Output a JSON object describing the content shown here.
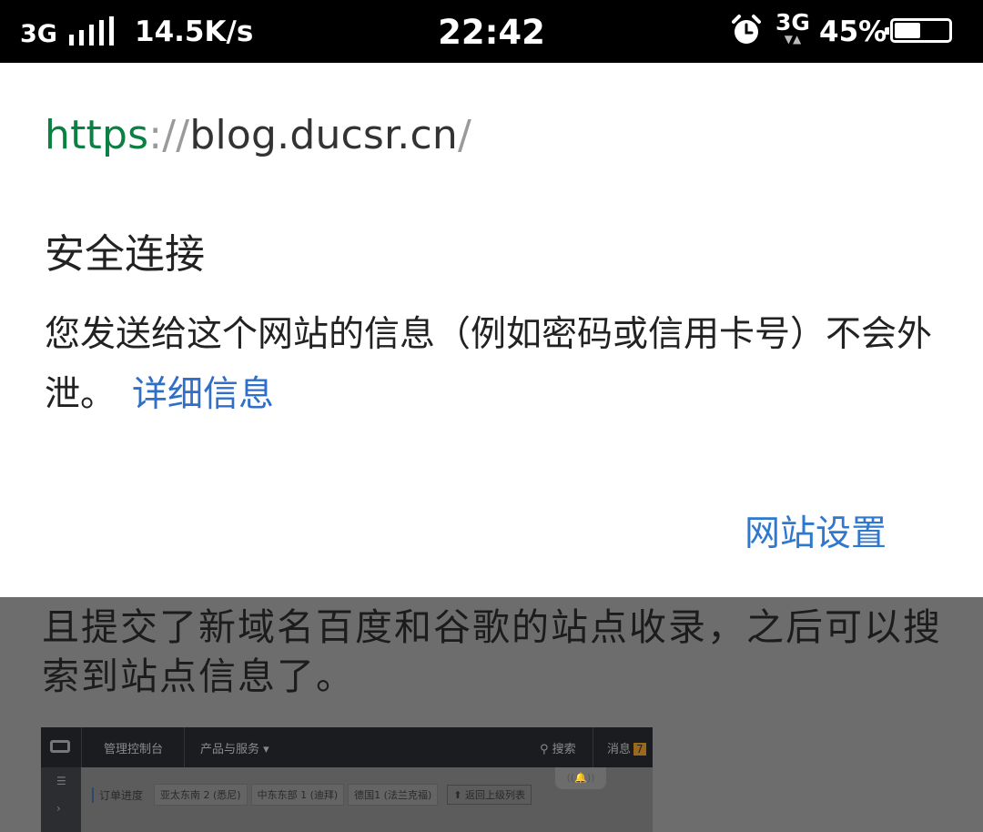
{
  "status_bar": {
    "network": "3G",
    "speed": "14.5K/s",
    "time": "22:42",
    "network2": "3G",
    "network2_arrows": "▼▲",
    "battery_percent": "45%",
    "battery_level": 0.45,
    "icons": [
      "signal-bars-icon",
      "alarm-clock-icon",
      "battery-icon"
    ]
  },
  "security_popup": {
    "url_scheme": "https",
    "url_sep": "://",
    "url_host": "blog.ducsr.cn",
    "url_slash": "/",
    "title": "安全连接",
    "description": "您发送给这个网站的信息（例如密码或信用卡号）不会外泄。",
    "details_link": "详细信息",
    "site_settings": "网站设置",
    "colors": {
      "scheme": "#0b8043",
      "link": "#2f6fc8"
    }
  },
  "background_page": {
    "text": "且提交了新域名百度和谷歌的站点收录，之后可以搜索到站点信息了。",
    "screenshot": {
      "nav_console": "管理控制台",
      "nav_products": "产品与服务 ▾",
      "nav_search": "搜索",
      "nav_messages": "消息",
      "messages_count": "7",
      "bell_text": "((🔔))",
      "breadcrumb": "订单进度",
      "tabs": [
        "亚太东南 2 (悉尼)",
        "中东东部 1 (迪拜)",
        "德国1 (法兰克福)"
      ],
      "back_button": "⬆ 返回上级列表"
    }
  }
}
